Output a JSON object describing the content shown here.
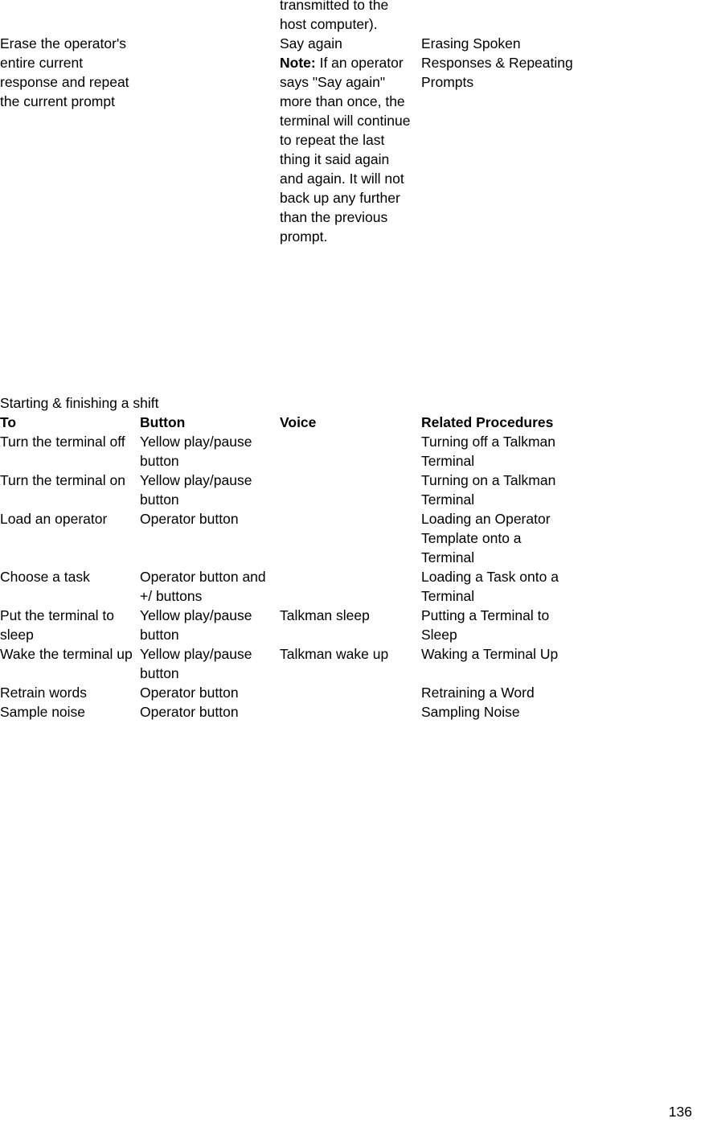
{
  "document": {
    "page_number": "136"
  },
  "continued_table": {
    "rows": [
      {
        "to": "",
        "button": "",
        "voice": "transmitted to the host computer).",
        "related": ""
      },
      {
        "to": "Erase the operator's entire current response and repeat the current prompt",
        "button": "",
        "voice_line1": "Say again",
        "voice_note_label": "Note:",
        "voice_note_text": " If an operator says \"Say again\" more than once, the terminal will continue to repeat the last thing it said again and again. It will not back up any further than the previous prompt.",
        "related": "Erasing Spoken Responses & Repeating Prompts"
      }
    ]
  },
  "shift_section": {
    "heading": "Starting & finishing a shift",
    "headers": {
      "to": "To",
      "button": "Button",
      "voice": "Voice",
      "related": "Related Procedures"
    },
    "rows": [
      {
        "to": "Turn the terminal off",
        "button": "Yellow play/pause button",
        "voice": "",
        "related": "Turning off a Talkman Terminal"
      },
      {
        "to": "Turn the terminal on",
        "button": "Yellow play/pause button",
        "voice": "",
        "related": "Turning on a Talkman Terminal"
      },
      {
        "to": "Load an operator",
        "button": "Operator button",
        "voice": "",
        "related": "Loading an Operator Template onto a Terminal"
      },
      {
        "to": "Choose a task",
        "button": "Operator button and +/ buttons",
        "voice": "",
        "related": "Loading a Task onto a Terminal"
      },
      {
        "to": "Put the terminal to sleep",
        "button": "Yellow play/pause button",
        "voice": "Talkman sleep",
        "related": "Putting a Terminal to Sleep"
      },
      {
        "to": "Wake the terminal up",
        "button": "Yellow play/pause button",
        "voice": "Talkman wake up",
        "related": "Waking a Terminal Up"
      },
      {
        "to": "Retrain words",
        "button": "Operator button",
        "voice": "",
        "related": "Retraining a Word"
      },
      {
        "to": "Sample noise",
        "button": "Operator button",
        "voice": "",
        "related": "Sampling Noise"
      }
    ]
  }
}
